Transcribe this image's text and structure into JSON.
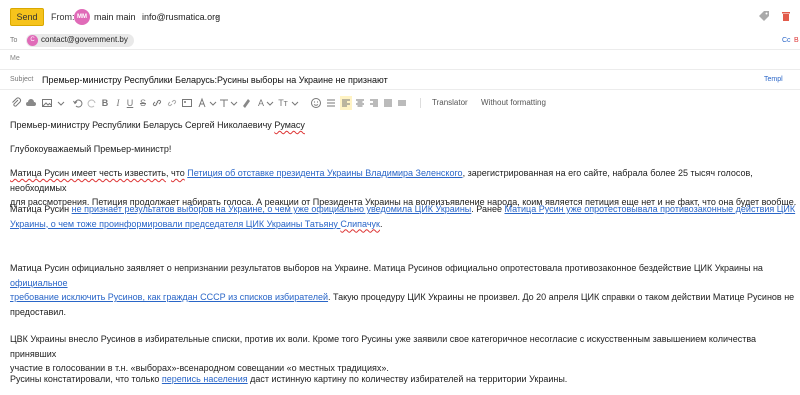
{
  "header": {
    "send_label": "Send",
    "from_label": "From:",
    "from_avatar": "MM",
    "from_name": "main main",
    "from_email": "info@rusmatica.org",
    "from_chevron": "⌄",
    "tag_icon": "tag-icon",
    "trash_icon": "trash-icon"
  },
  "to": {
    "label": "To",
    "chip_avatar": "C",
    "chip_email": "contact@government.by",
    "cc_label": "Cc",
    "bcc_label": "B"
  },
  "me_label": "Me",
  "subject": {
    "label": "Subject",
    "value": "Премьер-министру Республики Беларусь:Русины выборы на Украине не признают",
    "templates_label": "Templ"
  },
  "toolbar": {
    "translator_label": "Translator",
    "without_formatting_label": "Without formatting"
  },
  "body": {
    "salutation_line1_a": "Премьер-министру Республики Беларусь Сергей Николаевичу ",
    "salutation_line1_b": "Румасу",
    "greeting": "Глубокоуважаемый Премьер-министр!",
    "p1_a": "Матица Русин имеет честь известить",
    "p1_b": ", ",
    "p1_c": "что",
    "p1_d": " ",
    "p1_link": "Петиция об отставке президента Украины Владимира Зеленского",
    "p1_e": ", зарегистрированная на его сайте, набрала более 25 тысяч голосов, необходимых",
    "p1_line2": "для рассмотрения. Петиция продолжает набирать голоса. А реакции от Президента Украины на волеизъявление народа, коим является петиция еще нет и не факт, что она будет вообще.",
    "p2_a": "Матица Русин ",
    "p2_link1": "не признает результатов выборов на Украине, о чем уже официально уведомила ЦИК Украины",
    "p2_b": ". Ранее ",
    "p2_link2": "Матица Русин уже опротестовывала противозаконные действия ЦИК",
    "p2_line2_link": "Украины, о чем тоже проинформировали председателя ЦИК Украины Татьяну ",
    "p2_line2_sq": "Слипачук",
    "p2_line2_end": ".",
    "p3_a": "Матица Русин официально заявляет о непризнании результатов выборов на Украине. Матицa Русинов официально опротестовала противозаконное бездействие ЦИК Украины на ",
    "p3_link1": "официальное",
    "p3_line2_link": "требование исключить Русинов, как граждан СССР из списков избирателей",
    "p3_line2_rest": ". Такую процедуру ЦИК Украины не произвел. До 20 апреля ЦИК справки о таком действии Матице Русинов не",
    "p3_line3": "предоставил.",
    "p4_line1": "ЦВК Украины внесло Русинов в избирательные списки, против их воли. Кроме того Русины уже заявили свое категоричное несогласие с искусственным завышением количества принявших",
    "p4_line2": "участие в голосовании в т.н. «выборах»-всенародном совещании «о местных традициях».",
    "p5_a": "Русины констатировали, что только ",
    "p5_link": "перепись населения",
    "p5_b": " даст истинную картину по количеству избирателей на территории Украины."
  }
}
